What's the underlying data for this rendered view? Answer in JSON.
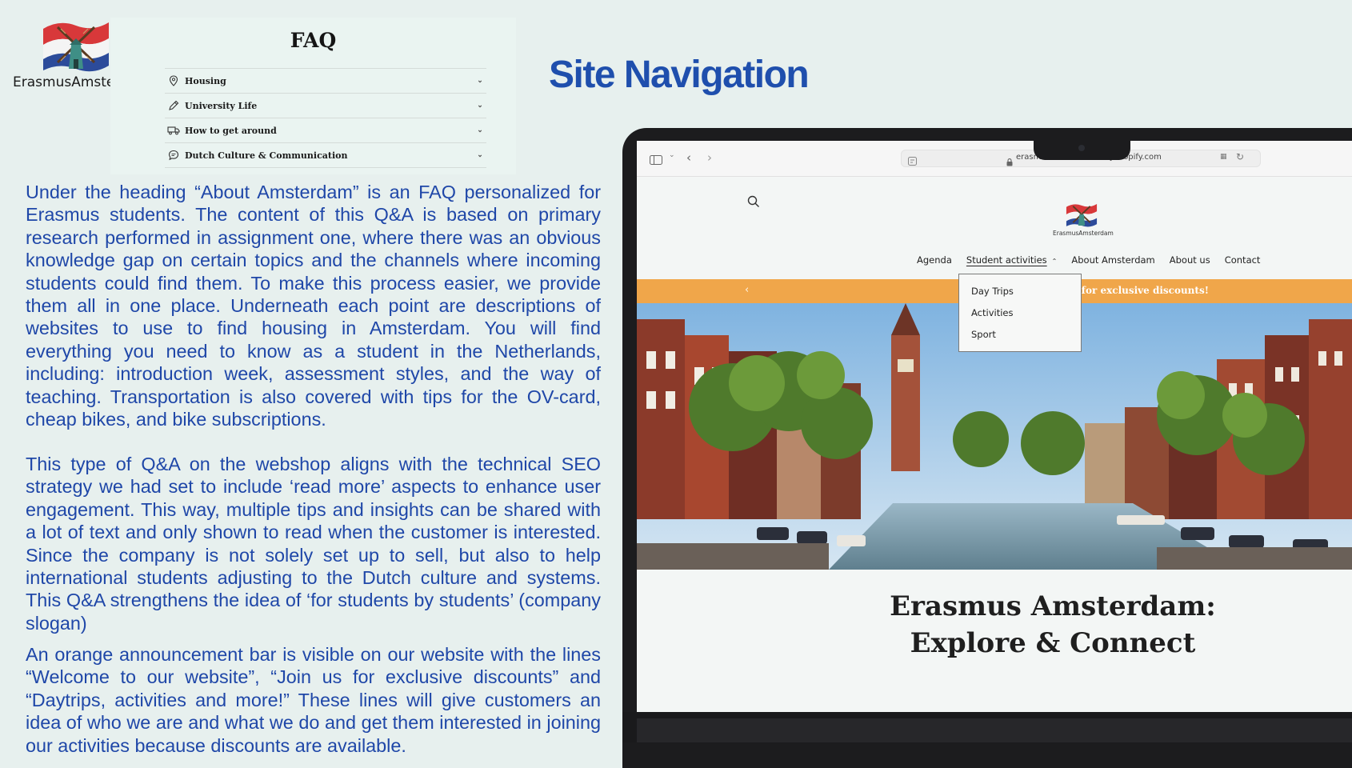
{
  "logo": {
    "text": "ErasmusAmsterdam"
  },
  "faq": {
    "title": "FAQ",
    "items": [
      {
        "label": "Housing",
        "icon": "map-pin-icon"
      },
      {
        "label": "University Life",
        "icon": "pencil-icon"
      },
      {
        "label": "How to get around",
        "icon": "truck-icon"
      },
      {
        "label": "Dutch Culture & Communication",
        "icon": "chat-bubble-icon"
      }
    ]
  },
  "heading": "Site Navigation",
  "paragraphs": [
    "Under the heading “About Amsterdam” is an FAQ personalized for Erasmus students. The content of this Q&A is based on primary research performed in assignment one, where there was an obvious knowledge gap on certain topics and the channels where incoming students could find them. To make this process easier, we provide them all in one place. Underneath each point are descriptions of websites to use to find housing in Amsterdam. You will find everything you need to know as a student in the Netherlands, including: introduction week, assessment styles, and the way of teaching. Transportation is also covered with tips for the OV-card, cheap bikes, and bike subscriptions.",
    "This type of Q&A on the webshop aligns with the technical SEO strategy we had set to include ‘read more’ aspects to enhance user engagement. This way, multiple tips and insights can be shared with a lot of text and only shown to read when the customer is interested. Since the company is not solely set up to sell, but also to help international students adjusting to the Dutch culture and systems. This Q&A strengthens the idea of ‘for students by students’ (company slogan)",
    "An orange announcement bar is visible on our website with the lines “Welcome to our website”, “Join us for exclusive discounts” and “Daytrips, activities and more!” These lines will give customers an idea of who we are and what we do and get them interested in joining our activities because discounts are available."
  ],
  "browser": {
    "url": "erasmus-amsterdam.myshopify.com"
  },
  "site": {
    "logo_text": "ErasmusAmsterdam",
    "nav": [
      "Agenda",
      "Student activities",
      "About Amsterdam",
      "About us",
      "Contact"
    ],
    "dropdown": [
      "Day Trips",
      "Activities",
      "Sport"
    ],
    "announcement": "Join us for exclusive discounts!",
    "hero_heading": "Erasmus Amsterdam: Explore & Connect"
  },
  "colors": {
    "heading": "#1f4fad",
    "body_text": "#1f47a8",
    "announcement_bar": "#f0a64a",
    "background": "#e7f0ee"
  }
}
